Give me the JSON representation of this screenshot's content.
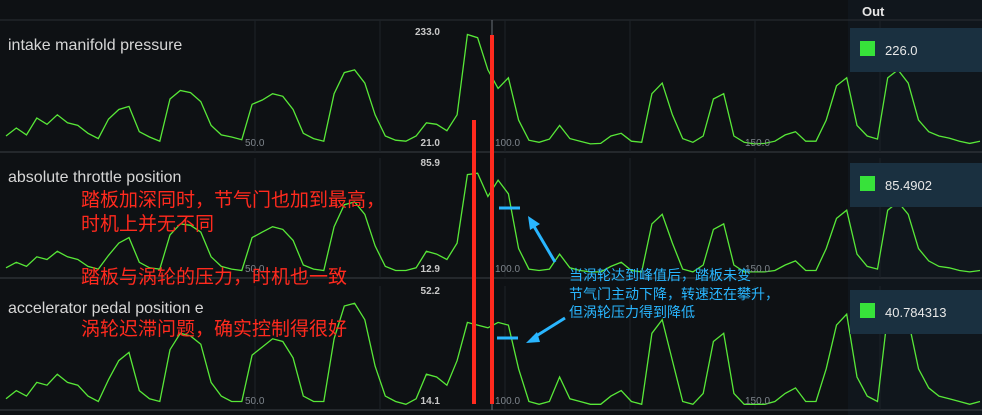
{
  "header": {
    "out_label": "Out"
  },
  "colors": {
    "trace": "#58e838",
    "marker": "#ff2a1e",
    "annotation_blue": "#29b6ff",
    "indicator": "#37e23a",
    "readout_bg": "#1a3040"
  },
  "chart_data": [
    {
      "type": "line",
      "title": "intake manifold pressure",
      "y_max_label": "233.0",
      "y_min_label": "21.0",
      "ylim": [
        21.0,
        233.0
      ],
      "x_tick_labels": [
        "50.0",
        "100.0",
        "150.0"
      ],
      "readout": "226.0",
      "x": [
        0,
        2,
        4,
        6,
        8,
        10,
        12,
        14,
        16,
        18,
        20,
        22,
        24,
        26,
        28,
        30,
        32,
        34,
        36,
        38,
        40,
        42,
        44,
        46,
        48,
        50,
        52,
        54,
        56,
        58,
        60,
        62,
        64,
        66,
        68,
        70,
        72,
        74,
        76,
        78,
        80,
        82,
        84,
        86,
        88,
        90,
        92,
        94,
        96,
        98,
        100,
        102,
        104,
        106,
        108,
        110,
        112,
        114,
        116,
        118,
        120,
        122,
        124,
        126,
        128,
        130,
        132,
        134,
        136,
        138,
        140,
        142,
        144,
        146,
        148,
        150,
        152,
        154,
        156,
        158,
        160,
        162,
        164,
        166,
        168,
        170,
        172,
        174,
        176,
        178,
        180,
        182,
        184,
        186,
        188,
        190
      ],
      "values": [
        40,
        55,
        42,
        74,
        62,
        80,
        65,
        60,
        45,
        35,
        72,
        90,
        96,
        48,
        38,
        30,
        110,
        126,
        122,
        105,
        60,
        42,
        38,
        33,
        100,
        108,
        120,
        115,
        90,
        45,
        35,
        30,
        120,
        160,
        165,
        140,
        80,
        40,
        32,
        30,
        40,
        65,
        62,
        50,
        80,
        232,
        226,
        165,
        130,
        150,
        70,
        32,
        28,
        34,
        60,
        35,
        30,
        25,
        26,
        40,
        45,
        30,
        28,
        120,
        140,
        80,
        35,
        28,
        40,
        110,
        120,
        40,
        28,
        25,
        26,
        30,
        42,
        48,
        30,
        30,
        70,
        135,
        150,
        60,
        40,
        34,
        150,
        165,
        140,
        70,
        48,
        40,
        36,
        30,
        26,
        30
      ]
    },
    {
      "type": "line",
      "title": "absolute throttle position",
      "y_max_label": "85.9",
      "y_min_label": "12.9",
      "ylim": [
        12.9,
        85.9
      ],
      "x_tick_labels": [
        "50.0",
        "100.0",
        "150.0"
      ],
      "readout": "85.4902",
      "x": [
        0,
        2,
        4,
        6,
        8,
        10,
        12,
        14,
        16,
        18,
        20,
        22,
        24,
        26,
        28,
        30,
        32,
        34,
        36,
        38,
        40,
        42,
        44,
        46,
        48,
        50,
        52,
        54,
        56,
        58,
        60,
        62,
        64,
        66,
        68,
        70,
        72,
        74,
        76,
        78,
        80,
        82,
        84,
        86,
        88,
        90,
        92,
        94,
        96,
        98,
        100,
        102,
        104,
        106,
        108,
        110,
        112,
        114,
        116,
        118,
        120,
        122,
        124,
        126,
        128,
        130,
        132,
        134,
        136,
        138,
        140,
        142,
        144,
        146,
        148,
        150,
        152,
        154,
        156,
        158,
        160,
        162,
        164,
        166,
        168,
        170,
        172,
        174,
        176,
        178,
        180,
        182,
        184,
        186,
        188,
        190
      ],
      "values": [
        16,
        20,
        17,
        24,
        22,
        28,
        24,
        22,
        17,
        15,
        25,
        34,
        38,
        20,
        16,
        15,
        40,
        48,
        47,
        42,
        24,
        17,
        15,
        14,
        38,
        42,
        46,
        44,
        36,
        18,
        15,
        14,
        46,
        62,
        64,
        55,
        32,
        17,
        14,
        14,
        16,
        28,
        26,
        22,
        34,
        84,
        85,
        68,
        80,
        70,
        30,
        15,
        14,
        15,
        26,
        16,
        14,
        13,
        13,
        17,
        20,
        14,
        13,
        48,
        55,
        34,
        15,
        13,
        18,
        44,
        48,
        18,
        13,
        13,
        13,
        14,
        18,
        21,
        14,
        14,
        30,
        52,
        58,
        26,
        17,
        15,
        58,
        64,
        55,
        30,
        21,
        17,
        16,
        14,
        13,
        14
      ]
    },
    {
      "type": "line",
      "title": "accelerator pedal position e",
      "y_max_label": "52.2",
      "y_min_label": "14.1",
      "ylim": [
        14.1,
        52.2
      ],
      "x_tick_labels": [
        "50.0",
        "100.0",
        "150.0"
      ],
      "readout": "40.784313",
      "x": [
        0,
        2,
        4,
        6,
        8,
        10,
        12,
        14,
        16,
        18,
        20,
        22,
        24,
        26,
        28,
        30,
        32,
        34,
        36,
        38,
        40,
        42,
        44,
        46,
        48,
        50,
        52,
        54,
        56,
        58,
        60,
        62,
        64,
        66,
        68,
        70,
        72,
        74,
        76,
        78,
        80,
        82,
        84,
        86,
        88,
        90,
        92,
        94,
        96,
        98,
        100,
        102,
        104,
        106,
        108,
        110,
        112,
        114,
        116,
        118,
        120,
        122,
        124,
        126,
        128,
        130,
        132,
        134,
        136,
        138,
        140,
        142,
        144,
        146,
        148,
        150,
        152,
        154,
        156,
        158,
        160,
        162,
        164,
        166,
        168,
        170,
        172,
        174,
        176,
        178,
        180,
        182,
        184,
        186,
        188,
        190
      ],
      "values": [
        16,
        19,
        17,
        22,
        21,
        25,
        22,
        21,
        17,
        15,
        23,
        30,
        33,
        19,
        16,
        15,
        34,
        40,
        39,
        36,
        22,
        17,
        15,
        15,
        32,
        35,
        38,
        37,
        31,
        17,
        15,
        15,
        38,
        50,
        51,
        45,
        28,
        17,
        15,
        14,
        16,
        25,
        24,
        21,
        30,
        44,
        43,
        42,
        44,
        43,
        27,
        15,
        14,
        15,
        24,
        16,
        15,
        14,
        14,
        17,
        19,
        15,
        14,
        40,
        45,
        30,
        15,
        14,
        18,
        37,
        40,
        18,
        14,
        14,
        14,
        15,
        18,
        20,
        15,
        15,
        27,
        43,
        47,
        24,
        17,
        15,
        47,
        51,
        45,
        27,
        20,
        17,
        16,
        15,
        14,
        15
      ]
    }
  ],
  "annotations": {
    "red": [
      "踏板加深同时，节气门也加到最高，",
      "时机上并无不同",
      "踏板与涡轮的压力，时机也一致",
      "涡轮迟滞问题，确实控制得很好"
    ],
    "blue": [
      "当涡轮达到峰值后，踏板未变",
      "节气门主动下降，转速还在攀升，",
      "但涡轮压力得到降低"
    ]
  }
}
